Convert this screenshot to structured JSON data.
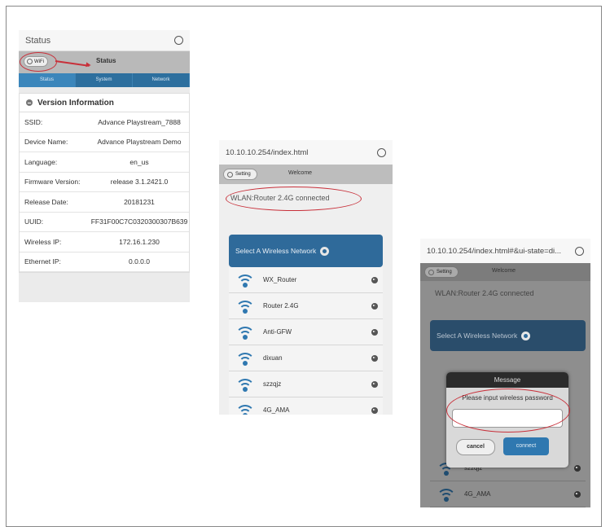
{
  "status_panel": {
    "url_title": "Status",
    "wifi_button": "WiFi",
    "page_title": "Status",
    "tabs": [
      "Status",
      "System",
      "Network"
    ],
    "section_title": "Version Information",
    "rows": [
      {
        "key": "SSID:",
        "value": "Advance Playstream_7888"
      },
      {
        "key": "Device Name:",
        "value": "Advance Playstream Demo"
      },
      {
        "key": "Language:",
        "value": "en_us"
      },
      {
        "key": "Firmware Version:",
        "value": "release 3.1.2421.0"
      },
      {
        "key": "Release Date:",
        "value": "20181231"
      },
      {
        "key": "UUID:",
        "value": "FF31F00C7C0320300307B639"
      },
      {
        "key": "Wireless IP:",
        "value": "172.16.1.230"
      },
      {
        "key": "Ethernet IP:",
        "value": "0.0.0.0"
      }
    ]
  },
  "network_panel": {
    "url": "10.10.10.254/index.html",
    "setting_button": "Setting",
    "page_title": "Welcome",
    "connection_status": "WLAN:Router 2.4G connected",
    "select_label": "Select A Wireless Network",
    "networks": [
      "WX_Router",
      "Router 2.4G",
      "Anti-GFW",
      "dixuan",
      "szzqjz",
      "4G_AMA"
    ]
  },
  "password_panel": {
    "url": "10.10.10.254/index.html#&ui-state=di...",
    "setting_button": "Setting",
    "page_title": "Welcome",
    "connection_status": "WLAN:Router 2.4G connected",
    "select_label": "Select A Wireless Network",
    "networks": [
      "szzqjz",
      "4G_AMA"
    ],
    "dialog": {
      "title": "Message",
      "prompt": "Please input wireless password",
      "cancel": "cancel",
      "ok": "connect"
    }
  }
}
